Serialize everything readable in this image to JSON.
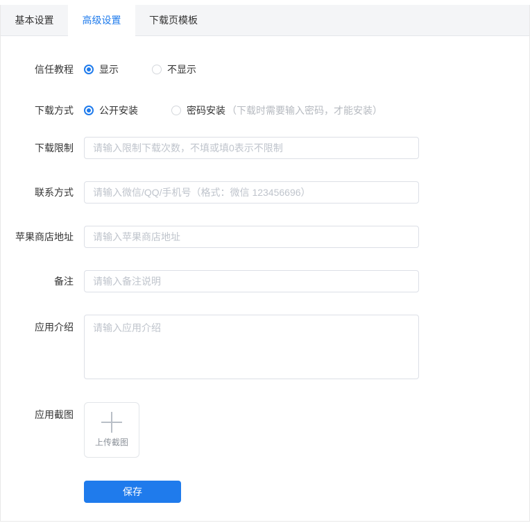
{
  "colors": {
    "accent_blue": "#1f7bec",
    "tabbar_bg": "#f4f5f7",
    "input_border": "#dcdfe6"
  },
  "tabs": [
    {
      "label": "基本设置",
      "active": false
    },
    {
      "label": "高级设置",
      "active": true
    },
    {
      "label": "下载页模板",
      "active": false
    }
  ],
  "form": {
    "trust_tutorial": {
      "label": "信任教程",
      "options": [
        {
          "label": "显示",
          "selected": true
        },
        {
          "label": "不显示",
          "selected": false
        }
      ]
    },
    "download_method": {
      "label": "下载方式",
      "options": [
        {
          "label": "公开安装",
          "selected": true
        },
        {
          "label": "密码安装",
          "selected": false
        }
      ],
      "hint": "（下载时需要输入密码，才能安装）"
    },
    "download_limit": {
      "label": "下载限制",
      "value": "",
      "placeholder": "请输入限制下载次数，不填或填0表示不限制"
    },
    "contact": {
      "label": "联系方式",
      "value": "",
      "placeholder": "请输入微信/QQ/手机号（格式：微信 123456696）"
    },
    "app_store_url": {
      "label": "苹果商店地址",
      "value": "",
      "placeholder": "请输入苹果商店地址"
    },
    "remark": {
      "label": "备注",
      "value": "",
      "placeholder": "请输入备注说明"
    },
    "app_intro": {
      "label": "应用介绍",
      "value": "",
      "placeholder": "请输入应用介绍"
    },
    "app_screenshot": {
      "label": "应用截图",
      "upload_text": "上传截图",
      "icon": "plus-icon"
    },
    "save_label": "保存"
  }
}
